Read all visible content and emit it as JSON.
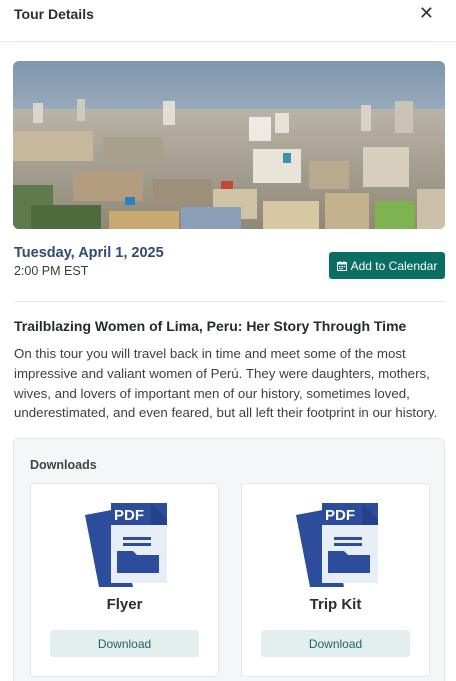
{
  "header": {
    "title": "Tour Details",
    "close_glyph": "✕",
    "close_icon": "close-icon"
  },
  "hero": {
    "image": "lima-cityscape",
    "sky_color": "#8fa6bb"
  },
  "event": {
    "date": "Tuesday, April 1, 2025",
    "time": "2:00 PM EST",
    "calendar_button": "Add to Calendar",
    "calendar_icon": "calendar-icon"
  },
  "tour": {
    "title": "Trailblazing Women of Lima, Peru: Her Story Through Time",
    "description": "On this tour you will travel back in time and meet some of the most impressive and valiant women of Perú. They were daughters, mothers, wives, and lovers of important men of our history, sometimes loved, underestimated, and even feared, but all left their footprint in our history."
  },
  "downloads": {
    "heading": "Downloads",
    "items": [
      {
        "label": "Flyer",
        "icon": "pdf-file-icon",
        "badge": "PDF",
        "button": "Download"
      },
      {
        "label": "Trip Kit",
        "icon": "pdf-file-icon",
        "badge": "PDF",
        "button": "Download"
      }
    ]
  },
  "colors": {
    "accent": "#0b6e63",
    "date_text": "#2f4a73",
    "download_button_bg": "#e3efef",
    "pdf_blue": "#2c4c9c"
  }
}
